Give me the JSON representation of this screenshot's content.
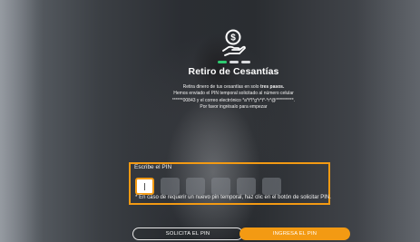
{
  "header": {
    "icon": "money-hand-icon",
    "steps_total": 3,
    "steps_current": 1,
    "title": "Retiro de Cesantías"
  },
  "description": {
    "line1_prefix": "Retira dinero de tus cesantías en solo ",
    "line1_bold": "tres pasos.",
    "line2": "Hemos enviado el PIN temporal solicitado al número celular",
    "line3": "******00843 y el correo electrónico *a*t*l*g*r*t*-*r*@**********.",
    "line4": "Por favor ingrésalo para empezar"
  },
  "pin": {
    "label": "Escribe el PIN",
    "digits": [
      "",
      "",
      "",
      "",
      "",
      ""
    ],
    "note": "* En caso de requerir un nuevo pin temporal, haz clic en el botón de solicitar PIN."
  },
  "buttons": {
    "request_pin": "SOLICITA EL PIN",
    "enter_pin": "INGRESA EL PIN"
  },
  "colors": {
    "accent": "#f39a13",
    "step_active": "#2ecc71"
  }
}
